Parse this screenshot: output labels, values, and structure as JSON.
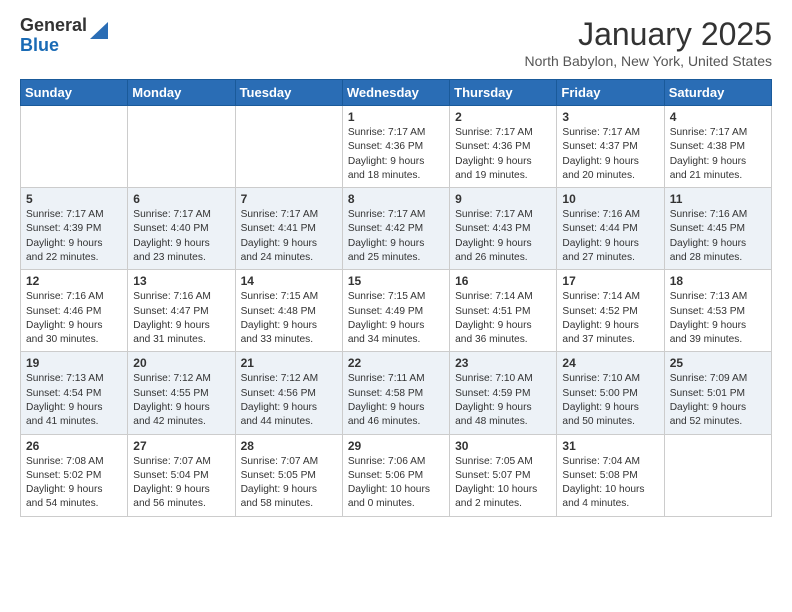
{
  "header": {
    "logo_general": "General",
    "logo_blue": "Blue",
    "month": "January 2025",
    "location": "North Babylon, New York, United States"
  },
  "weekdays": [
    "Sunday",
    "Monday",
    "Tuesday",
    "Wednesday",
    "Thursday",
    "Friday",
    "Saturday"
  ],
  "weeks": [
    [
      {
        "day": "",
        "info": ""
      },
      {
        "day": "",
        "info": ""
      },
      {
        "day": "",
        "info": ""
      },
      {
        "day": "1",
        "info": "Sunrise: 7:17 AM\nSunset: 4:36 PM\nDaylight: 9 hours\nand 18 minutes."
      },
      {
        "day": "2",
        "info": "Sunrise: 7:17 AM\nSunset: 4:36 PM\nDaylight: 9 hours\nand 19 minutes."
      },
      {
        "day": "3",
        "info": "Sunrise: 7:17 AM\nSunset: 4:37 PM\nDaylight: 9 hours\nand 20 minutes."
      },
      {
        "day": "4",
        "info": "Sunrise: 7:17 AM\nSunset: 4:38 PM\nDaylight: 9 hours\nand 21 minutes."
      }
    ],
    [
      {
        "day": "5",
        "info": "Sunrise: 7:17 AM\nSunset: 4:39 PM\nDaylight: 9 hours\nand 22 minutes."
      },
      {
        "day": "6",
        "info": "Sunrise: 7:17 AM\nSunset: 4:40 PM\nDaylight: 9 hours\nand 23 minutes."
      },
      {
        "day": "7",
        "info": "Sunrise: 7:17 AM\nSunset: 4:41 PM\nDaylight: 9 hours\nand 24 minutes."
      },
      {
        "day": "8",
        "info": "Sunrise: 7:17 AM\nSunset: 4:42 PM\nDaylight: 9 hours\nand 25 minutes."
      },
      {
        "day": "9",
        "info": "Sunrise: 7:17 AM\nSunset: 4:43 PM\nDaylight: 9 hours\nand 26 minutes."
      },
      {
        "day": "10",
        "info": "Sunrise: 7:16 AM\nSunset: 4:44 PM\nDaylight: 9 hours\nand 27 minutes."
      },
      {
        "day": "11",
        "info": "Sunrise: 7:16 AM\nSunset: 4:45 PM\nDaylight: 9 hours\nand 28 minutes."
      }
    ],
    [
      {
        "day": "12",
        "info": "Sunrise: 7:16 AM\nSunset: 4:46 PM\nDaylight: 9 hours\nand 30 minutes."
      },
      {
        "day": "13",
        "info": "Sunrise: 7:16 AM\nSunset: 4:47 PM\nDaylight: 9 hours\nand 31 minutes."
      },
      {
        "day": "14",
        "info": "Sunrise: 7:15 AM\nSunset: 4:48 PM\nDaylight: 9 hours\nand 33 minutes."
      },
      {
        "day": "15",
        "info": "Sunrise: 7:15 AM\nSunset: 4:49 PM\nDaylight: 9 hours\nand 34 minutes."
      },
      {
        "day": "16",
        "info": "Sunrise: 7:14 AM\nSunset: 4:51 PM\nDaylight: 9 hours\nand 36 minutes."
      },
      {
        "day": "17",
        "info": "Sunrise: 7:14 AM\nSunset: 4:52 PM\nDaylight: 9 hours\nand 37 minutes."
      },
      {
        "day": "18",
        "info": "Sunrise: 7:13 AM\nSunset: 4:53 PM\nDaylight: 9 hours\nand 39 minutes."
      }
    ],
    [
      {
        "day": "19",
        "info": "Sunrise: 7:13 AM\nSunset: 4:54 PM\nDaylight: 9 hours\nand 41 minutes."
      },
      {
        "day": "20",
        "info": "Sunrise: 7:12 AM\nSunset: 4:55 PM\nDaylight: 9 hours\nand 42 minutes."
      },
      {
        "day": "21",
        "info": "Sunrise: 7:12 AM\nSunset: 4:56 PM\nDaylight: 9 hours\nand 44 minutes."
      },
      {
        "day": "22",
        "info": "Sunrise: 7:11 AM\nSunset: 4:58 PM\nDaylight: 9 hours\nand 46 minutes."
      },
      {
        "day": "23",
        "info": "Sunrise: 7:10 AM\nSunset: 4:59 PM\nDaylight: 9 hours\nand 48 minutes."
      },
      {
        "day": "24",
        "info": "Sunrise: 7:10 AM\nSunset: 5:00 PM\nDaylight: 9 hours\nand 50 minutes."
      },
      {
        "day": "25",
        "info": "Sunrise: 7:09 AM\nSunset: 5:01 PM\nDaylight: 9 hours\nand 52 minutes."
      }
    ],
    [
      {
        "day": "26",
        "info": "Sunrise: 7:08 AM\nSunset: 5:02 PM\nDaylight: 9 hours\nand 54 minutes."
      },
      {
        "day": "27",
        "info": "Sunrise: 7:07 AM\nSunset: 5:04 PM\nDaylight: 9 hours\nand 56 minutes."
      },
      {
        "day": "28",
        "info": "Sunrise: 7:07 AM\nSunset: 5:05 PM\nDaylight: 9 hours\nand 58 minutes."
      },
      {
        "day": "29",
        "info": "Sunrise: 7:06 AM\nSunset: 5:06 PM\nDaylight: 10 hours\nand 0 minutes."
      },
      {
        "day": "30",
        "info": "Sunrise: 7:05 AM\nSunset: 5:07 PM\nDaylight: 10 hours\nand 2 minutes."
      },
      {
        "day": "31",
        "info": "Sunrise: 7:04 AM\nSunset: 5:08 PM\nDaylight: 10 hours\nand 4 minutes."
      },
      {
        "day": "",
        "info": ""
      }
    ]
  ]
}
